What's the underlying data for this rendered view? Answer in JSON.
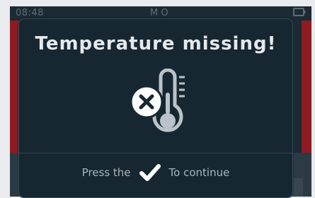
{
  "status_bar": {
    "time": "08:48",
    "center_label": "M O"
  },
  "dialog": {
    "title": "Temperature missing!",
    "icon": "thermometer-missing-icon",
    "footer": {
      "before": "Press the",
      "icon": "check-icon",
      "after": "To continue"
    }
  },
  "colors": {
    "dialog_background": "#162732",
    "alert_background": "#8e1b22",
    "text_primary": "#e5e9ec",
    "text_secondary": "#aab4ba"
  }
}
